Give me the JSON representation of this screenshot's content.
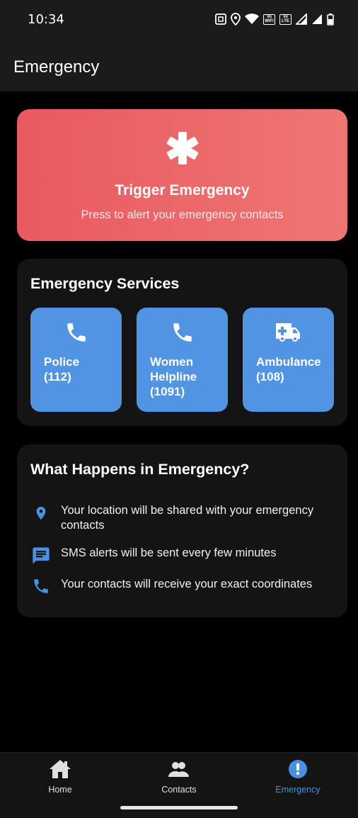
{
  "status_bar": {
    "time": "10:34",
    "badges": [
      "Vo WiFi",
      "Vo LTE"
    ]
  },
  "app_bar": {
    "title": "Emergency"
  },
  "trigger": {
    "title": "Trigger Emergency",
    "subtitle": "Press to alert your emergency contacts",
    "icon": "asterisk-icon",
    "gradient": [
      "#e95961",
      "#ee7672"
    ]
  },
  "services": {
    "title": "Emergency Services",
    "accent": "#5294e4",
    "items": [
      {
        "label": "Police\n(112)",
        "icon": "phone-icon"
      },
      {
        "label": "Women\nHelpline\n(1091)",
        "icon": "phone-icon"
      },
      {
        "label": "Ambulance\n(108)",
        "icon": "ambulance-icon"
      }
    ]
  },
  "info": {
    "title": "What Happens in Emergency?",
    "items": [
      {
        "icon": "location-pin-icon",
        "text": "Your location will be shared with your emergency contacts"
      },
      {
        "icon": "message-icon",
        "text": "SMS alerts will be sent every few minutes"
      },
      {
        "icon": "phone-icon",
        "text": "Your contacts will receive your exact coordinates"
      }
    ]
  },
  "bottom_nav": {
    "items": [
      {
        "label": "Home",
        "icon": "home-icon",
        "active": false
      },
      {
        "label": "Contacts",
        "icon": "people-icon",
        "active": false
      },
      {
        "label": "Emergency",
        "icon": "alert-circle-icon",
        "active": true
      }
    ],
    "active_color": "#4a90e2"
  }
}
